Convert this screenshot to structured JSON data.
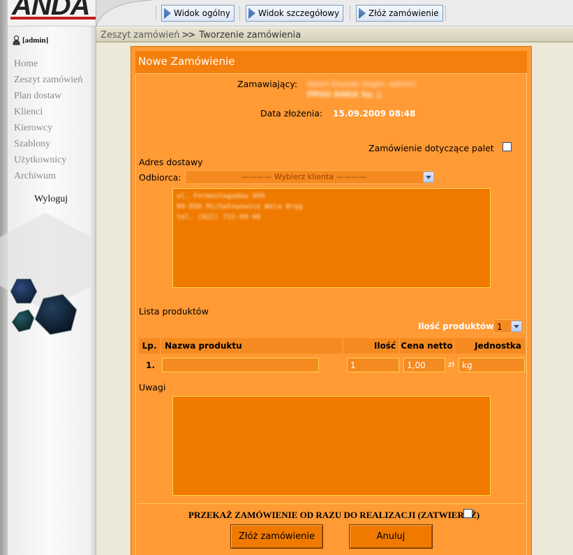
{
  "brand": {
    "logo_text": "ANDA"
  },
  "user": {
    "label": "[admin]"
  },
  "sidebar": {
    "items": [
      {
        "label": "Home"
      },
      {
        "label": "Zeszyt zamówień"
      },
      {
        "label": "Plan dostaw"
      },
      {
        "label": "Klienci"
      },
      {
        "label": "Kierowcy"
      },
      {
        "label": "Szablony"
      },
      {
        "label": "Użytkownicy"
      },
      {
        "label": "Archiwum"
      }
    ],
    "logout_label": "Wyloguj"
  },
  "toolbar": {
    "buttons": [
      {
        "label": "Widok ogólny"
      },
      {
        "label": "Widok szczegółowy"
      },
      {
        "label": "Złóż zamówienie"
      }
    ]
  },
  "breadcrumb": {
    "items": [
      "Zeszyt zamówień",
      "Tworzenie zamówienia"
    ],
    "separator": ">>"
  },
  "form": {
    "title": "Nowe Zamówienie",
    "orderer_label": "Zamawiający:",
    "orderer_value_line1": "Adam Duszak (login: admin)",
    "orderer_value_line2": "PPHU ANDA Sp. j.",
    "date_label": "Data złożenia:",
    "date_value": "15.09.2009 08:48",
    "pallet_label": "Zamówienie dotyczące palet",
    "pallet_checked": false,
    "delivery_heading": "Adres dostawy",
    "recipient_label": "Odbiorca:",
    "recipient_select_value": "———— Wybierz klienta ————",
    "address_lines": [
      "ul. Fermentagadow 999",
      "09-050 Michałowowice Wola Bręg",
      "tel. (022) 722-09-00"
    ],
    "products_heading": "Lista produktów",
    "product_count_label": "Ilość produktów:",
    "product_count_value": "1",
    "table_headers": {
      "lp": "Lp.",
      "name": "Nazwa produktu",
      "qty": "Ilość",
      "price": "Cena netto",
      "unit": "Jednostka"
    },
    "rows": [
      {
        "lp": "1.",
        "name": "",
        "qty": "1",
        "price": "1,00",
        "currency": "zł",
        "unit": "kg"
      }
    ],
    "notes_heading": "Uwagi",
    "notes_value": "",
    "confirm_label": "PRZEKAŻ ZAMÓWIENIE OD RAZU DO REALIZACJI (ZATWIERDŹ)",
    "confirm_checked": false,
    "submit_label": "Złóż zamówienie",
    "cancel_label": "Anuluj"
  },
  "colors": {
    "panel": "#ff9a35",
    "panel_header": "#f57f0d",
    "field": "#f07a00",
    "field_border": "#ffd34f",
    "logo_accent": "#c81a1a"
  }
}
